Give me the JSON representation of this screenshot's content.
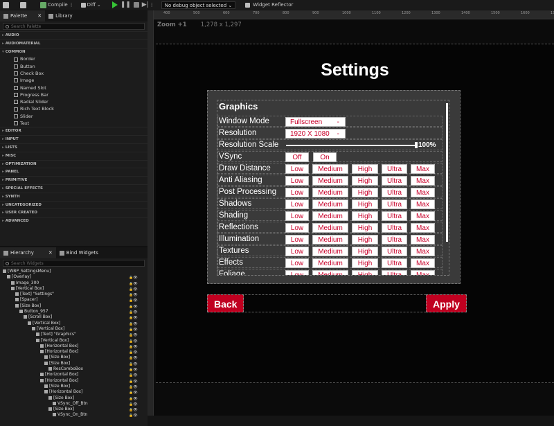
{
  "toolbar": {
    "compile": "Compile",
    "diff": "Diff",
    "debug_select": "No debug object selected",
    "widget_reflector": "Widget Reflector"
  },
  "palette": {
    "tab": "Palette",
    "library_tab": "Library",
    "search_placeholder": "Search Palette",
    "categories_top": [
      "AUDIO",
      "AUDIOMATERIAL"
    ],
    "common_label": "COMMON",
    "common_items": [
      "Border",
      "Button",
      "Check Box",
      "Image",
      "Named Slot",
      "Progress Bar",
      "Radial Slider",
      "Rich Text Block",
      "Slider",
      "Text"
    ],
    "categories_bottom": [
      "EDITOR",
      "INPUT",
      "LISTS",
      "MISC",
      "OPTIMIZATION",
      "PANEL",
      "PRIMITIVE",
      "SPECIAL EFFECTS",
      "SYNTH",
      "UNCATEGORIZED",
      "USER CREATED",
      "ADVANCED"
    ]
  },
  "hierarchy": {
    "tab": "Hierarchy",
    "bind_tab": "Bind Widgets",
    "search_placeholder": "Search Widgets",
    "rows": [
      {
        "label": "[WBP_SettingsMenu]",
        "indent": 0
      },
      {
        "label": "[Overlay]",
        "indent": 1
      },
      {
        "label": "Image_300",
        "indent": 2
      },
      {
        "label": "[Vertical Box]",
        "indent": 2
      },
      {
        "label": "[Text] \"Settings\"",
        "indent": 3
      },
      {
        "label": "[Spacer]",
        "indent": 3
      },
      {
        "label": "[Size Box]",
        "indent": 3
      },
      {
        "label": "Button_957",
        "indent": 4
      },
      {
        "label": "[Scroll Box]",
        "indent": 5
      },
      {
        "label": "[Vertical Box]",
        "indent": 6
      },
      {
        "label": "[Vertical Box]",
        "indent": 7
      },
      {
        "label": "[Text] \"Graphics\"",
        "indent": 8
      },
      {
        "label": "[Vertical Box]",
        "indent": 8
      },
      {
        "label": "[Horizontal Box]",
        "indent": 9
      },
      {
        "label": "[Horizontal Box]",
        "indent": 9
      },
      {
        "label": "[Size Box]",
        "indent": 10
      },
      {
        "label": "[Size Box]",
        "indent": 10
      },
      {
        "label": "ResComboBox",
        "indent": 11
      },
      {
        "label": "[Horizontal Box]",
        "indent": 9
      },
      {
        "label": "[Horizontal Box]",
        "indent": 9
      },
      {
        "label": "[Size Box]",
        "indent": 10
      },
      {
        "label": "[Horizontal Box]",
        "indent": 10
      },
      {
        "label": "[Size Box]",
        "indent": 11
      },
      {
        "label": "VSync_Off_Btn",
        "indent": 12
      },
      {
        "label": "[Size Box]",
        "indent": 11
      },
      {
        "label": "VSync_On_Btn",
        "indent": 12
      }
    ]
  },
  "ruler": [
    "400",
    "500",
    "600",
    "700",
    "800",
    "900",
    "1000",
    "1100",
    "1200",
    "1300",
    "1400",
    "1500",
    "1600",
    "1700"
  ],
  "canvas": {
    "zoom": "Zoom +1",
    "resolution": "1,278 x 1,297"
  },
  "settings": {
    "title": "Settings",
    "section": "Graphics",
    "window_mode": {
      "label": "Window Mode",
      "value": "Fullscreen",
      "arrow": "-"
    },
    "resolution": {
      "label": "Resolution",
      "value": "1920 X 1080",
      "arrow": "-"
    },
    "resolution_scale": {
      "label": "Resolution Scale",
      "value": "100%",
      "fraction": 1.0
    },
    "vsync": {
      "label": "VSync",
      "off": "Off",
      "on": "On"
    },
    "quality_options": [
      "Low",
      "Medium",
      "High",
      "Ultra",
      "Max"
    ],
    "quality_rows": [
      "Draw Distance",
      "Anti Aliasing",
      "Post Processing",
      "Shadows",
      "Shading",
      "Reflections",
      "Illumination",
      "Textures",
      "Effects",
      "Foliage"
    ],
    "back": "Back",
    "apply": "Apply"
  }
}
